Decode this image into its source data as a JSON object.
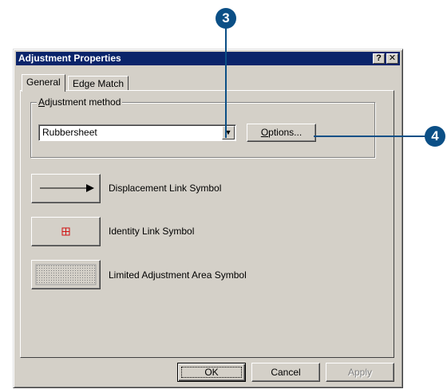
{
  "dialog": {
    "title": "Adjustment Properties",
    "help_button": "?",
    "close_button": "✕"
  },
  "tabs": [
    {
      "label": "General",
      "active": true
    },
    {
      "label": "Edge Match",
      "active": false
    }
  ],
  "adjustment_method": {
    "legend_first": "A",
    "legend_rest": "djustment method",
    "selected": "Rubbersheet",
    "options_first": "O",
    "options_rest": "ptions..."
  },
  "symbols": {
    "displacement_label": "Displacement Link Symbol",
    "identity_label": "Identity Link Symbol",
    "limited_area_label": "Limited Adjustment Area Symbol"
  },
  "footer": {
    "ok_label": "OK",
    "cancel_label": "Cancel",
    "apply_label": "Apply"
  },
  "callouts": {
    "step3": "3",
    "step4": "4"
  },
  "colors": {
    "titlebar": "#0a246a",
    "callout": "#0b4f86",
    "dialog_bg": "#d4d0c8"
  }
}
